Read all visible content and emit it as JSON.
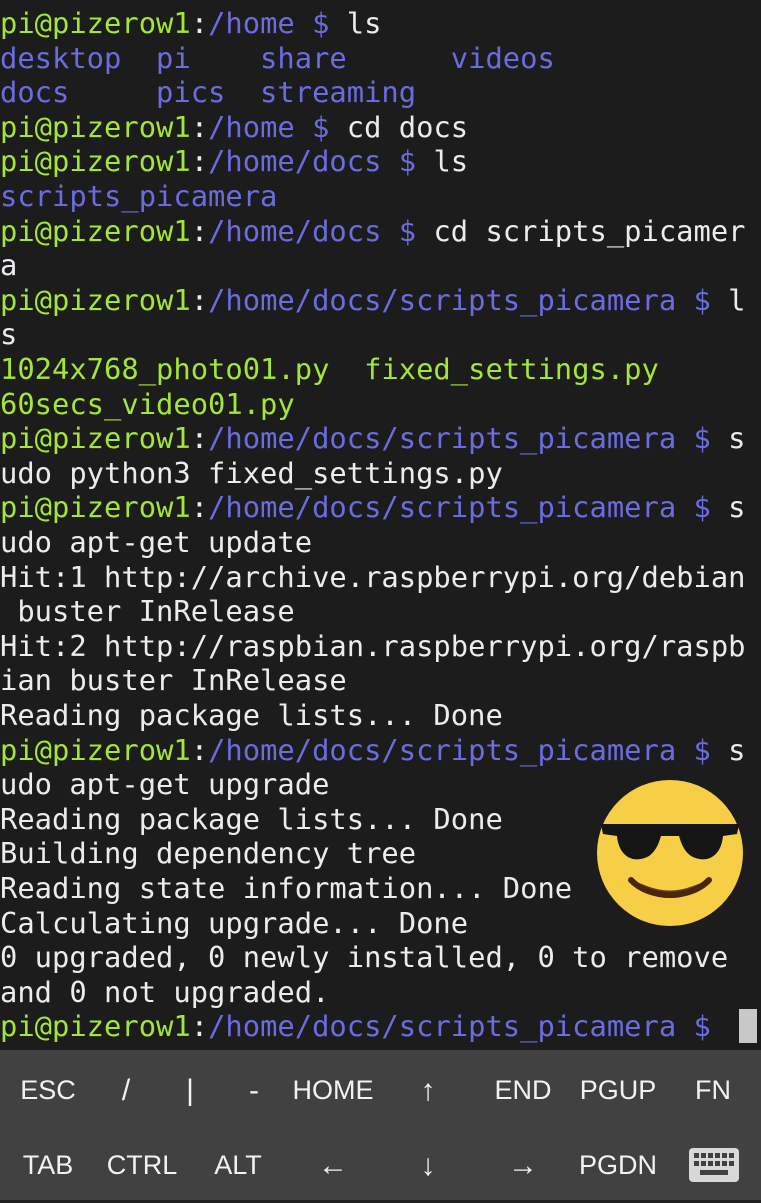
{
  "terminal": {
    "lines": [
      [
        {
          "t": "pi@pizerow1",
          "c": "user"
        },
        {
          "t": ":",
          "c": "plain"
        },
        {
          "t": "/home $",
          "c": "path"
        },
        {
          "t": " ls",
          "c": "plain"
        }
      ],
      [
        {
          "t": "desktop  pi    share      videos",
          "c": "dir"
        }
      ],
      [
        {
          "t": "docs     pics  streaming",
          "c": "dir"
        }
      ],
      [
        {
          "t": "pi@pizerow1",
          "c": "user"
        },
        {
          "t": ":",
          "c": "plain"
        },
        {
          "t": "/home $",
          "c": "path"
        },
        {
          "t": " cd docs",
          "c": "plain"
        }
      ],
      [
        {
          "t": "pi@pizerow1",
          "c": "user"
        },
        {
          "t": ":",
          "c": "plain"
        },
        {
          "t": "/home/docs $",
          "c": "path"
        },
        {
          "t": " ls",
          "c": "plain"
        }
      ],
      [
        {
          "t": "scripts_picamera",
          "c": "dir"
        }
      ],
      [
        {
          "t": "pi@pizerow1",
          "c": "user"
        },
        {
          "t": ":",
          "c": "plain"
        },
        {
          "t": "/home/docs $",
          "c": "path"
        },
        {
          "t": " cd scripts_picamer",
          "c": "plain"
        }
      ],
      [
        {
          "t": "a",
          "c": "plain"
        }
      ],
      [
        {
          "t": "pi@pizerow1",
          "c": "user"
        },
        {
          "t": ":",
          "c": "plain"
        },
        {
          "t": "/home/docs/scripts_picamera $",
          "c": "path"
        },
        {
          "t": " l",
          "c": "plain"
        }
      ],
      [
        {
          "t": "s",
          "c": "plain"
        }
      ],
      [
        {
          "t": "1024x768_photo01.py  fixed_settings.py",
          "c": "exe"
        }
      ],
      [
        {
          "t": "60secs_video01.py",
          "c": "exe"
        }
      ],
      [
        {
          "t": "pi@pizerow1",
          "c": "user"
        },
        {
          "t": ":",
          "c": "plain"
        },
        {
          "t": "/home/docs/scripts_picamera $",
          "c": "path"
        },
        {
          "t": " s",
          "c": "plain"
        }
      ],
      [
        {
          "t": "udo python3 fixed_settings.py",
          "c": "plain"
        }
      ],
      [
        {
          "t": "pi@pizerow1",
          "c": "user"
        },
        {
          "t": ":",
          "c": "plain"
        },
        {
          "t": "/home/docs/scripts_picamera $",
          "c": "path"
        },
        {
          "t": " s",
          "c": "plain"
        }
      ],
      [
        {
          "t": "udo apt-get update",
          "c": "plain"
        }
      ],
      [
        {
          "t": "Hit:1 http://archive.raspberrypi.org/debian",
          "c": "plain"
        }
      ],
      [
        {
          "t": " buster InRelease",
          "c": "plain"
        }
      ],
      [
        {
          "t": "Hit:2 http://raspbian.raspberrypi.org/raspb",
          "c": "plain"
        }
      ],
      [
        {
          "t": "ian buster InRelease",
          "c": "plain"
        }
      ],
      [
        {
          "t": "Reading package lists... Done",
          "c": "plain"
        }
      ],
      [
        {
          "t": "pi@pizerow1",
          "c": "user"
        },
        {
          "t": ":",
          "c": "plain"
        },
        {
          "t": "/home/docs/scripts_picamera $",
          "c": "path"
        },
        {
          "t": " s",
          "c": "plain"
        }
      ],
      [
        {
          "t": "udo apt-get upgrade",
          "c": "plain"
        }
      ],
      [
        {
          "t": "Reading package lists... Done",
          "c": "plain"
        }
      ],
      [
        {
          "t": "Building dependency tree",
          "c": "plain"
        }
      ],
      [
        {
          "t": "Reading state information... Done",
          "c": "plain"
        }
      ],
      [
        {
          "t": "Calculating upgrade... Done",
          "c": "plain"
        }
      ],
      [
        {
          "t": "0 upgraded, 0 newly installed, 0 to remove",
          "c": "plain"
        }
      ],
      [
        {
          "t": "and 0 not upgraded.",
          "c": "plain"
        }
      ],
      [
        {
          "t": "pi@pizerow1",
          "c": "user"
        },
        {
          "t": ":",
          "c": "plain"
        },
        {
          "t": "/home/docs/scripts_picamera $",
          "c": "path"
        }
      ]
    ]
  },
  "keys": {
    "row1": [
      "ESC",
      "/",
      "|",
      "-",
      "HOME",
      "↑",
      "END",
      "PGUP",
      "FN"
    ],
    "row2": [
      "TAB",
      "CTRL",
      "ALT",
      "←",
      "↓",
      "→",
      "PGDN"
    ]
  },
  "icons": {
    "emoji": "smiling-face-with-sunglasses-icon",
    "keyboard": "keyboard-icon"
  },
  "colors": {
    "background": "#1c1c1c",
    "user": "#a3e635",
    "path": "#6a6ce0",
    "text": "#ececec",
    "keybar": "#414141"
  }
}
